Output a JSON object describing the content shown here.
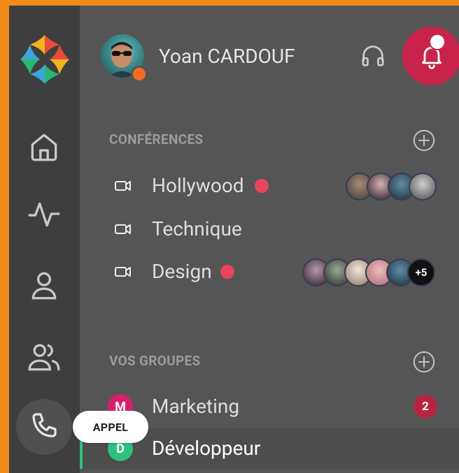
{
  "user": {
    "name": "Yoan CARDOUF",
    "status_color": "#f36c21"
  },
  "rail": {
    "items": [
      {
        "name": "home",
        "icon": "home-icon"
      },
      {
        "name": "activity",
        "icon": "activity-icon"
      },
      {
        "name": "contacts",
        "icon": "user-icon"
      },
      {
        "name": "groups",
        "icon": "users-icon"
      },
      {
        "name": "call",
        "icon": "phone-icon",
        "tooltip": "APPEL",
        "active": true
      }
    ]
  },
  "notifications": {
    "accent": "#c8234b",
    "has_unread": true
  },
  "conferences": {
    "title": "CONFÉRENCES",
    "items": [
      {
        "label": "Hollywood",
        "live": true,
        "participants": 4,
        "more": ""
      },
      {
        "label": "Technique",
        "live": false,
        "participants": 0,
        "more": ""
      },
      {
        "label": "Design",
        "live": true,
        "participants": 5,
        "more": "+5"
      }
    ]
  },
  "groups": {
    "title": "VOS GROUPES",
    "items": [
      {
        "initial": "M",
        "label": "Marketing",
        "color": "#d6206e",
        "unread": "2",
        "active": false
      },
      {
        "initial": "D",
        "label": "Développeur",
        "color": "#2ec27e",
        "unread": "",
        "active": true
      }
    ]
  }
}
